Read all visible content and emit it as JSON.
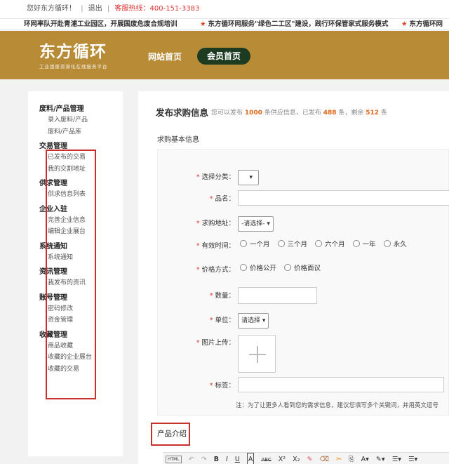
{
  "topbar": {
    "greeting": "您好东方循环！",
    "logout": "退出",
    "hotline_label": "客服热线：",
    "hotline": "400-151-3383"
  },
  "ticker": {
    "items": [
      "环网率队开赴青浦工业园区，开展国废危废合规培训",
      "东方循环网服务\"绿色二工区\"建设，践行环保管家式服务模式",
      "东方循环网"
    ]
  },
  "header": {
    "logo_text": "东方循环",
    "logo_sub": "工业固废资源化在线服务平台",
    "nav_home": "网站首页",
    "nav_member": "会员首页"
  },
  "sidebar": [
    {
      "title": "废料/产品管理",
      "items": [
        "录入废料/产品",
        "废料/产品库"
      ]
    },
    {
      "title": "交易管理",
      "items": [
        "已发布的交易",
        "我的交割地址"
      ]
    },
    {
      "title": "供求管理",
      "items": [
        "供求信息列表"
      ]
    },
    {
      "title": "企业入驻",
      "items": [
        "完善企业信息",
        "编辑企业展台"
      ]
    },
    {
      "title": "系统通知",
      "items": [
        "系统通知"
      ]
    },
    {
      "title": "资讯管理",
      "items": [
        "我发布的资讯"
      ]
    },
    {
      "title": "账号管理",
      "items": [
        "密码修改",
        "资金管理"
      ]
    },
    {
      "title": "收藏管理",
      "items": [
        "商品收藏",
        "收藏的企业展台",
        "收藏的交易"
      ]
    }
  ],
  "main": {
    "title": "发布求购信息",
    "quota": {
      "prefix": "您可以发布",
      "total": "1000",
      "mid": "条供应信息，已发布",
      "published": "488",
      "mid2": "条，剩余",
      "remaining": "512",
      "suffix": "条"
    },
    "section_basic": "求购基本信息",
    "form": {
      "category_label": "选择分类：",
      "name_label": "品名：",
      "address_label": "求购地址：",
      "address_value": "-请选择-",
      "validity_label": "有效时间：",
      "validity_options": [
        "一个月",
        "三个月",
        "六个月",
        "一年",
        "永久"
      ],
      "price_label": "价格方式：",
      "price_options": [
        "价格公开",
        "价格面议"
      ],
      "qty_label": "数量：",
      "unit_label": "单位：",
      "unit_value": "请选择",
      "image_label": "图片上传：",
      "tags_label": "标签：",
      "note": "注：为了让更多人看到您的需求信息，建议您填写多个关键词，并用英文逗号"
    },
    "section_intro": "产品介绍",
    "editor_tools": [
      "HTML",
      "↶",
      "↷",
      "B",
      "I",
      "U",
      "A",
      "ABC",
      "X²",
      "X₂",
      "✎",
      "⌫",
      "✂",
      "⎘",
      "A▾",
      "✎▾",
      "☰▾",
      "☰▾"
    ]
  }
}
